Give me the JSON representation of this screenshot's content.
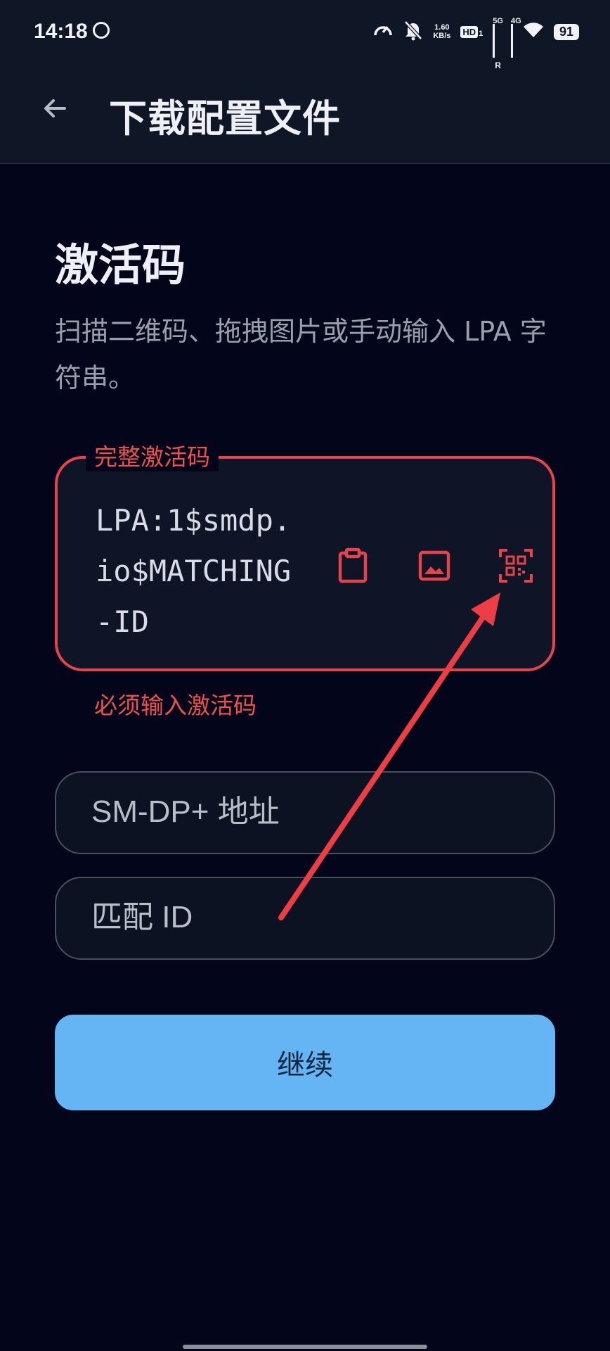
{
  "status_bar": {
    "time": "14:18",
    "net_speed_value": "1.60",
    "net_speed_unit": "KB/s",
    "hd_label": "HD",
    "hd_sub": "1",
    "sim1_label": "5G",
    "sim1_roaming": "R",
    "sim2_label": "4G",
    "battery": "91"
  },
  "header": {
    "back_icon": "arrow-left-icon",
    "title": "下载配置文件"
  },
  "main": {
    "section_title": "激活码",
    "subtitle": "扫描二维码、拖拽图片或手动输入 LPA 字符串。",
    "activation_field": {
      "label": "完整激活码",
      "value": "LPA:1$smdp.io$MATCHING-ID",
      "error": "必须输入激活码",
      "icons": [
        "clipboard-icon",
        "image-icon",
        "qr-scan-icon"
      ]
    },
    "smdp_field": {
      "placeholder": "SM-DP+ 地址"
    },
    "matching_field": {
      "placeholder": "匹配 ID"
    },
    "continue_label": "继续"
  },
  "colors": {
    "error": "#e5454a",
    "primary_button": "#65b4f4",
    "background": "#03061a",
    "app_bar": "#0f1626"
  }
}
